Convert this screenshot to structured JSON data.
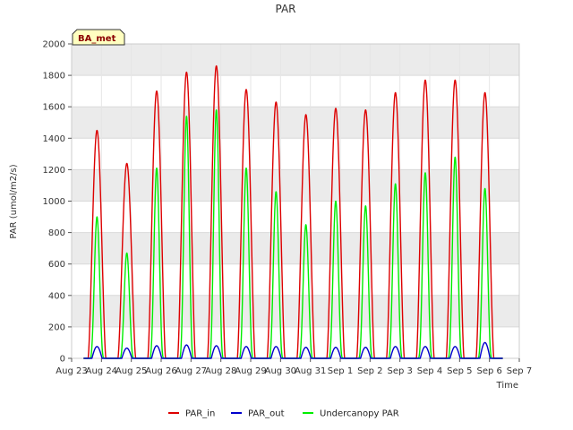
{
  "chart_data": {
    "type": "line",
    "title": "PAR",
    "xlabel": "Time",
    "ylabel": "PAR (umol/m2/s)",
    "badge": "BA_met",
    "xlim": [
      0,
      15
    ],
    "ylim": [
      0,
      2000
    ],
    "yticks": [
      0,
      200,
      400,
      600,
      800,
      1000,
      1200,
      1400,
      1600,
      1800,
      2000
    ],
    "xticks": [
      0,
      1,
      2,
      3,
      4,
      5,
      6,
      7,
      8,
      9,
      10,
      11,
      12,
      13,
      14,
      15
    ],
    "xtick_labels": [
      "Aug 23",
      "Aug 24",
      "Aug 25",
      "Aug 26",
      "Aug 27",
      "Aug 28",
      "Aug 29",
      "Aug 30",
      "Aug 31",
      "Sep 1",
      "Sep 2",
      "Sep 3",
      "Sep 4",
      "Sep 5",
      "Sep 6",
      "Sep 7"
    ],
    "grid": true,
    "band_fill": "#ebebeb",
    "legend_position": "bottom-center",
    "day_centers": [
      0.85,
      1.85,
      2.85,
      3.85,
      4.85,
      5.85,
      6.85,
      7.85,
      8.85,
      9.85,
      10.85,
      11.85,
      12.85,
      13.85
    ],
    "series": [
      {
        "name": "PAR_in",
        "color": "#dd0000",
        "daily_peaks": [
          1450,
          1240,
          1700,
          1820,
          1860,
          1710,
          1630,
          1550,
          1590,
          1580,
          1690,
          1770,
          1770,
          1690
        ]
      },
      {
        "name": "PAR_out",
        "color": "#0000cc",
        "daily_peaks": [
          75,
          65,
          80,
          85,
          80,
          75,
          75,
          70,
          70,
          70,
          75,
          75,
          75,
          100
        ]
      },
      {
        "name": "Undercanopy PAR",
        "color": "#00ee00",
        "daily_peaks": [
          900,
          670,
          1210,
          1540,
          1580,
          1210,
          1060,
          850,
          1000,
          970,
          1110,
          1180,
          1280,
          1080
        ]
      }
    ]
  }
}
